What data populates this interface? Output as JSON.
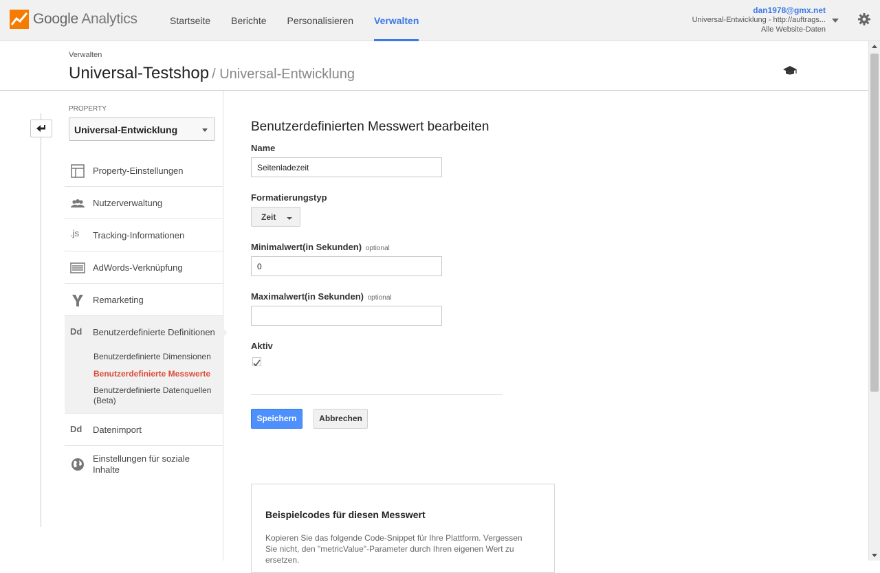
{
  "topbar": {
    "brand_google": "Google",
    "brand_product": "Analytics",
    "nav": [
      {
        "label": "Startseite"
      },
      {
        "label": "Berichte"
      },
      {
        "label": "Personalisieren"
      },
      {
        "label": "Verwalten"
      }
    ],
    "active_nav": "Verwalten",
    "account_email": "dan1978@gmx.net",
    "account_property": "Universal-Entwicklung - http://auftrags...",
    "account_view": "Alle Website-Daten",
    "accent_color": "#3b78e7"
  },
  "header": {
    "breadcrumb": "Verwalten",
    "title": "Universal-Testshop",
    "subtitle": "/ Universal-Entwicklung"
  },
  "sidebar": {
    "property_label": "PROPERTY",
    "property_value": "Universal-Entwicklung",
    "items": [
      {
        "label": "Property-Einstellungen",
        "icon": "layout-icon"
      },
      {
        "label": "Nutzerverwaltung",
        "icon": "users-icon"
      },
      {
        "label": "Tracking-Informationen",
        "icon": "js-icon",
        "icon_text": ".js"
      },
      {
        "label": "AdWords-Verknüpfung",
        "icon": "adwords-icon"
      },
      {
        "label": "Remarketing",
        "icon": "remarketing-icon"
      },
      {
        "label": "Benutzerdefinierte Definitionen",
        "icon": "dd-icon",
        "icon_text": "Dd"
      },
      {
        "label": "Datenimport",
        "icon": "dd-icon",
        "icon_text": "Dd"
      },
      {
        "label": "Einstellungen für soziale Inhalte",
        "icon": "globe-icon"
      }
    ],
    "sub_items": [
      {
        "label": "Benutzerdefinierte Dimensionen"
      },
      {
        "label": "Benutzerdefinierte Messwerte"
      },
      {
        "label": "Benutzerdefinierte Datenquellen (Beta)"
      }
    ],
    "active_sub_color": "#dd4b39"
  },
  "form": {
    "title": "Benutzerdefinierten Messwert bearbeiten",
    "name_label": "Name",
    "name_value": "Seitenladezeit",
    "format_label": "Formatierungstyp",
    "format_value": "Zeit",
    "min_label": "Minimalwert(in Sekunden)",
    "min_optional": "optional",
    "min_value": "0",
    "max_label": "Maximalwert(in Sekunden)",
    "max_optional": "optional",
    "max_value": "",
    "active_label": "Aktiv",
    "active_checked": true,
    "save_label": "Speichern",
    "cancel_label": "Abbrechen"
  },
  "sample": {
    "title": "Beispielcodes für diesen Messwert",
    "text": "Kopieren Sie das folgende Code-Snippet für Ihre Plattform. Vergessen Sie nicht, den \"metricValue\"-Parameter durch Ihren eigenen Wert zu ersetzen."
  }
}
